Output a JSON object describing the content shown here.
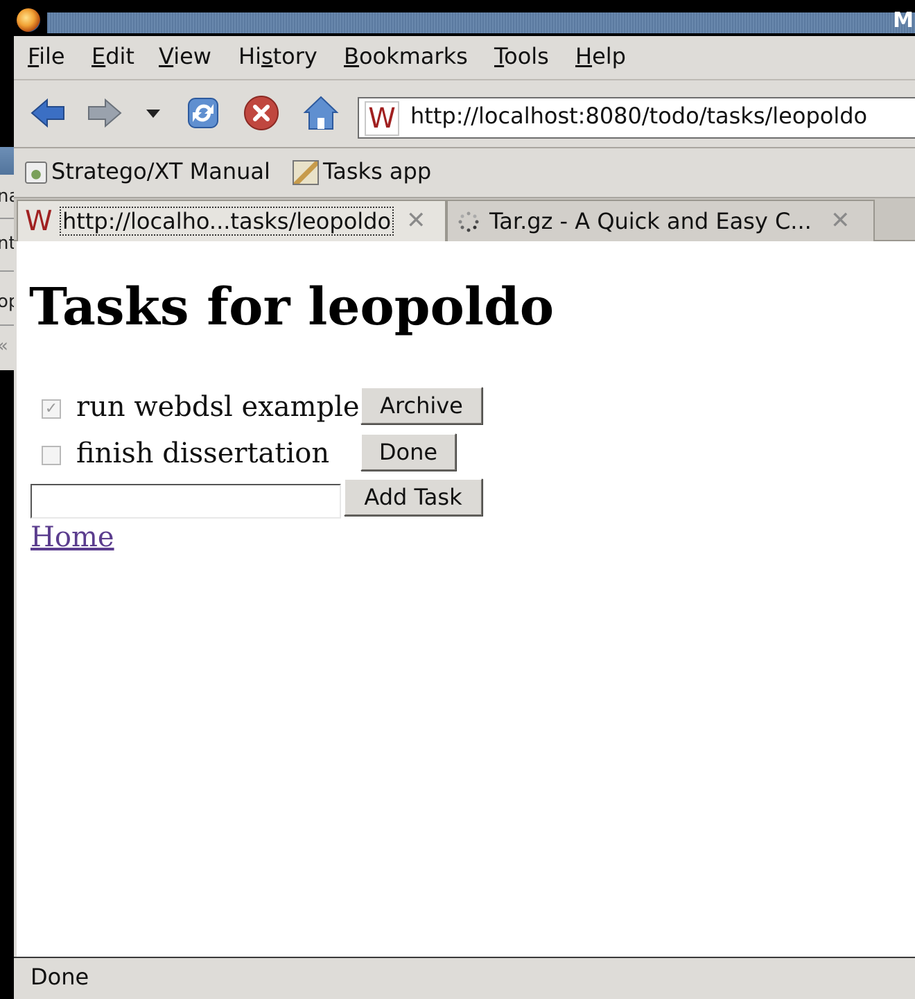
{
  "window": {
    "title_fragment": "M"
  },
  "left_window": {
    "fragments": [
      "na",
      "nt",
      "op",
      "«"
    ]
  },
  "menu": [
    "File",
    "Edit",
    "View",
    "History",
    "Bookmarks",
    "Tools",
    "Help"
  ],
  "navbar": {
    "icons": [
      "back-arrow-icon",
      "forward-arrow-icon",
      "dropdown-arrow-icon",
      "reload-icon",
      "stop-icon",
      "home-icon"
    ],
    "url": "http://localhost:8080/todo/tasks/leopoldo",
    "url_favicon": "W"
  },
  "bookmarks": [
    {
      "label": "Stratego/XT Manual",
      "icon": "page-icon"
    },
    {
      "label": "Tasks app",
      "icon": "image-icon"
    }
  ],
  "tabs": [
    {
      "favicon": "W",
      "title": "http://localho...tasks/leopoldo",
      "active": true
    },
    {
      "favicon": "loading-spinner",
      "title": "Tar.gz - A Quick and Easy C...",
      "active": false
    }
  ],
  "page": {
    "title": "Tasks for leopoldo",
    "tasks": [
      {
        "label": "run webdsl example",
        "checked": true,
        "button": "Archive"
      },
      {
        "label": "finish dissertation",
        "checked": false,
        "button": "Done"
      }
    ],
    "new_task_value": "",
    "add_button": "Add Task",
    "home_link": "Home"
  },
  "status": {
    "text": "Done"
  },
  "colors": {
    "title_bar": "#5b7aa0",
    "chrome": "#dedcd8",
    "link_visited": "#5b3d8e",
    "favicon_red": "#a02020"
  }
}
